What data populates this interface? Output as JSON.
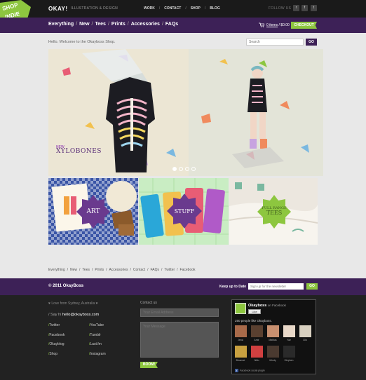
{
  "ribbon": {
    "line1": "SHOP",
    "line2": "INDIE"
  },
  "brand": {
    "logo": "OKAY!",
    "tagline": "ILLUSTRATION & DESIGN"
  },
  "topnav": {
    "items": [
      "WORK",
      "CONTACT",
      "SHOP",
      "BLOG"
    ],
    "sep": "/"
  },
  "follow": {
    "label": "FOLLOW US",
    "icons": [
      "rss-icon",
      "facebook-icon",
      "twitter-icon"
    ],
    "glyphs": [
      "r",
      "f",
      "t"
    ]
  },
  "catnav": {
    "items": [
      "Everything",
      "New",
      "Tees",
      "Prints",
      "Accessories",
      "FAQs"
    ],
    "sep": "/"
  },
  "cart": {
    "items": "0 items",
    "sep": " / ",
    "total": "$0.00",
    "checkout": "CHECKOUT"
  },
  "welcome": "Hello. Welcome to the Okayboss Shop.",
  "search": {
    "placeholder": "Search",
    "button": "GO"
  },
  "hero": {
    "new": "NEW",
    "title": "XYLOBONES",
    "dots": 4,
    "active_dot": 0
  },
  "tiles": [
    {
      "label": "ART"
    },
    {
      "label": "STUFF"
    },
    {
      "line1": "FULL RANGE",
      "line2": "TEES"
    }
  ],
  "footer_nav": [
    "Everything",
    "New",
    "Tees",
    "Prints",
    "Accessories",
    "Contact",
    "FAQs",
    "Twitter",
    "Facebook"
  ],
  "copyright": "© 2011 OkayBoss",
  "newsletter": {
    "label": "Keep up to Date",
    "placeholder": "Sign up for the newsletter",
    "button": "GO"
  },
  "love": "♥ Love from Sydney, Australia ♥",
  "sayhi": {
    "prefix": "/ Say hi ",
    "email": "hello@okayboss.com"
  },
  "links_left": [
    "Twitter",
    "Facebook",
    "Okayblog",
    "Shop"
  ],
  "links_right": [
    "YouTube",
    "Tumblr",
    "Last.fm",
    "Instagram"
  ],
  "contact": {
    "title": "Contact us",
    "email_placeholder": "Your Email Address",
    "message_placeholder": "Your Message",
    "submit": "BOOM!"
  },
  "facebook": {
    "name": "Okayboss",
    "on": "on Facebook",
    "like": "Like",
    "count": "250 people like Okayboss.",
    "people": [
      "Jessi",
      "Amir",
      "Mattias",
      "Yaz",
      "Clio",
      "Bluamei",
      "Nillo",
      "Mindy",
      "Stephen"
    ],
    "plugin": "Facebook social plugin"
  },
  "colors": {
    "purple": "#3d2157",
    "green": "#8dc63f",
    "dark": "#1a1a1a"
  }
}
